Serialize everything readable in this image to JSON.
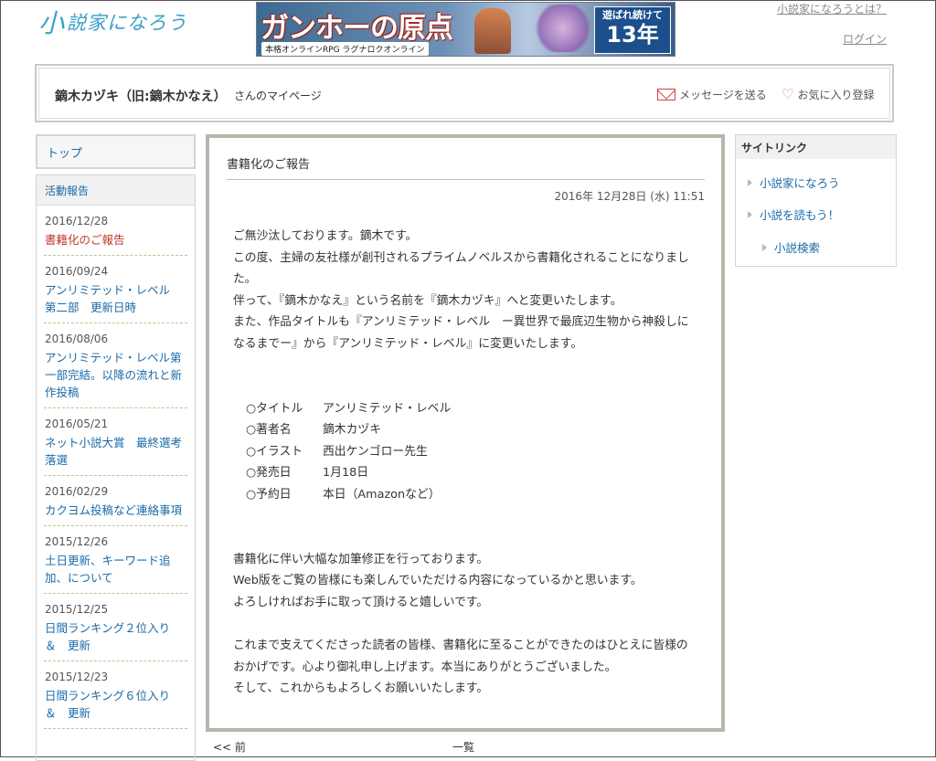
{
  "header": {
    "logo_mark": "小",
    "logo_text": "説家になろう",
    "banner": {
      "headline": "ガンホーの原点",
      "sub": "本格オンラインRPG ラグナロクオンライン",
      "badge_top": "遊ばれ続けて",
      "badge_num": "13年"
    },
    "about_link": "小説家になろうとは？",
    "login_link": "ログイン"
  },
  "userbar": {
    "name": "鏑木カヅキ（旧:鏑木かなえ）",
    "suffix": "さんのマイページ",
    "message_label": "メッセージを送る",
    "favorite_label": "お気に入り登録"
  },
  "leftnav": {
    "top_label": "トップ",
    "section_label": "活動報告",
    "items": [
      {
        "date": "2016/12/28",
        "title": "書籍化のご報告"
      },
      {
        "date": "2016/09/24",
        "title": "アンリミテッド・レベル　第二部　更新日時"
      },
      {
        "date": "2016/08/06",
        "title": "アンリミテッド・レベル第一部完結。以降の流れと新作投稿"
      },
      {
        "date": "2016/05/21",
        "title": "ネット小説大賞　最終選考落選"
      },
      {
        "date": "2016/02/29",
        "title": "カクヨム投稿など連絡事項"
      },
      {
        "date": "2015/12/26",
        "title": "土日更新、キーワード追加、について"
      },
      {
        "date": "2015/12/25",
        "title": "日間ランキング２位入り　＆　更新"
      },
      {
        "date": "2015/12/23",
        "title": "日間ランキング６位入り　＆　更新"
      }
    ]
  },
  "post": {
    "title": "書籍化のご報告",
    "date": "2016年 12月28日 (水) 11:51",
    "p1": [
      "ご無沙汰しております。鏑木です。",
      "この度、主婦の友社様が創刊されるプライムノベルスから書籍化されることになりました。",
      "伴って、『鏑木かなえ』という名前を『鏑木カヅキ』へと変更いたします。",
      "また、作品タイトルも『アンリミテッド・レベル　ー異世界で最底辺生物から神殺しになるまでー』から『アンリミテッド・レベル』に変更いたします。"
    ],
    "info": [
      {
        "label": "○タイトル",
        "value": "アンリミテッド・レベル"
      },
      {
        "label": "○著者名",
        "value": "鏑木カヅキ"
      },
      {
        "label": "○イラスト",
        "value": "西出ケンゴロー先生"
      },
      {
        "label": "○発売日",
        "value": "1月18日"
      },
      {
        "label": "○予約日",
        "value": "本日（Amazonなど）"
      }
    ],
    "p2": [
      "書籍化に伴い大幅な加筆修正を行っております。",
      "Web版をご覧の皆様にも楽しんでいただける内容になっているかと思います。",
      "よろしければお手に取って頂けると嬉しいです。"
    ],
    "p3": [
      "これまで支えてくださった読者の皆様、書籍化に至ることができたのはひとえに皆様のおかげです。心より御礼申し上げます。本当にありがとうございました。",
      "そして、これからもよろしくお願いいたします。"
    ]
  },
  "bottomnav": {
    "prev_label": "<< 前",
    "list_label": "一覧"
  },
  "sitelinks": {
    "heading": "サイトリンク",
    "items": [
      {
        "label": "小説家になろう"
      },
      {
        "label": "小説を読もう！"
      },
      {
        "label": "小説検索"
      }
    ]
  },
  "colors": {
    "link": "#1a6aa8",
    "current": "#c0392b",
    "main_border": "#b6b7ac",
    "logo": "#3aa0c8"
  }
}
